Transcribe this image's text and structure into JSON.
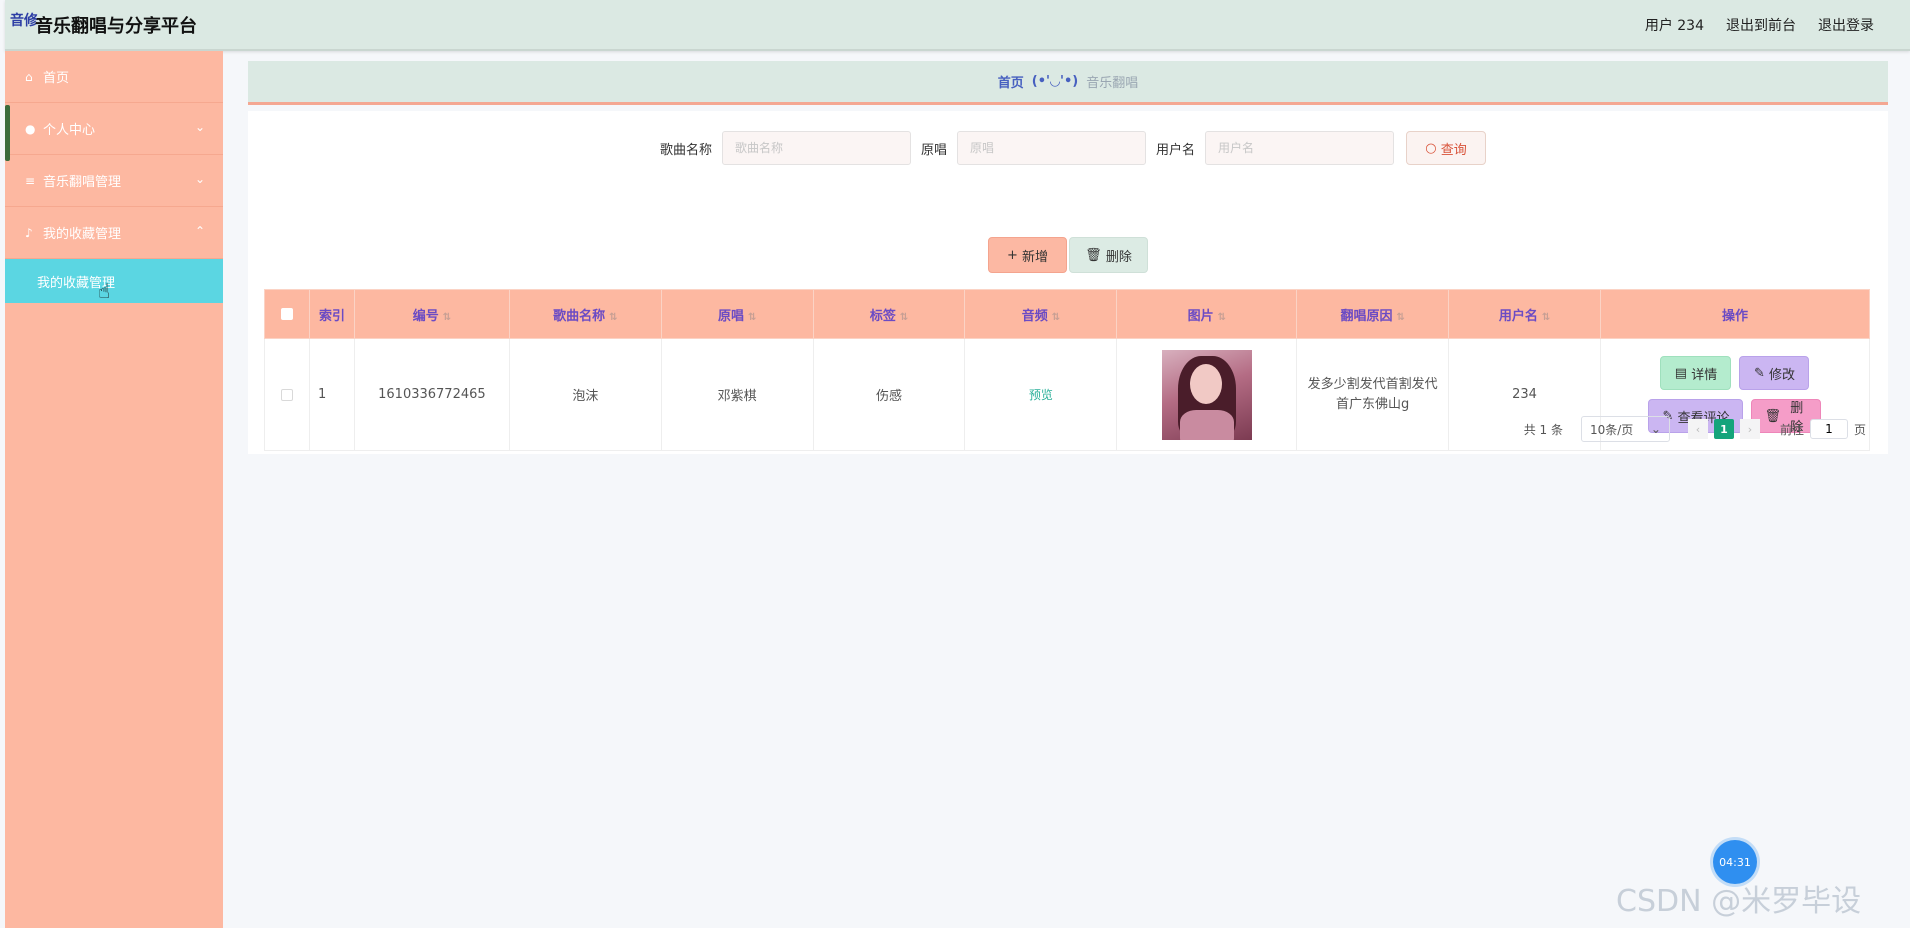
{
  "app": {
    "logo_badge": "音修",
    "title": "音乐翻唱与分享平台",
    "user_label": "用户 234",
    "to_front": "退出到前台",
    "logout": "退出登录"
  },
  "sidebar": {
    "items": [
      {
        "label": "首页",
        "icon": "home-icon"
      },
      {
        "label": "个人中心",
        "icon": "user-icon",
        "chevron": "⌄"
      },
      {
        "label": "音乐翻唱管理",
        "icon": "list-icon",
        "chevron": "⌄"
      },
      {
        "label": "我的收藏管理",
        "icon": "mic-icon",
        "chevron": "⌃"
      }
    ],
    "sub_item": "我的收藏管理"
  },
  "breadcrumb": {
    "home": "首页",
    "face": "(•'◡'•)",
    "current": "音乐翻唱"
  },
  "search": {
    "song_label": "歌曲名称",
    "song_placeholder": "歌曲名称",
    "original_label": "原唱",
    "original_placeholder": "原唱",
    "user_label": "用户名",
    "user_placeholder": "用户名",
    "query_btn": "查询"
  },
  "actions": {
    "add": "新增",
    "delete": "删除"
  },
  "table": {
    "headers": {
      "index": "索引",
      "id": "编号",
      "song": "歌曲名称",
      "original": "原唱",
      "tag": "标签",
      "audio": "音频",
      "image": "图片",
      "reason": "翻唱原因",
      "username": "用户名",
      "ops": "操作"
    },
    "rows": [
      {
        "index": "1",
        "id": "1610336772465",
        "song": "泡沫",
        "original": "邓紫棋",
        "tag": "伤感",
        "audio": "预览",
        "reason": "发多少割发代首割发代首广东佛山g",
        "username": "234",
        "ops": {
          "detail": "详情",
          "edit": "修改",
          "comment": "查看评论",
          "delete": "删除"
        }
      }
    ]
  },
  "pagination": {
    "total": "共 1 条",
    "page_size": "10条/页",
    "current": "1",
    "goto_label": "前往",
    "goto_value": "1",
    "page_suffix": "页"
  },
  "overlay": {
    "timer": "04:31",
    "watermark": "CSDN @米罗毕设"
  },
  "colors": {
    "sidebar": "#fdb8a1",
    "active_sub": "#5bd6e2",
    "header": "#dbe9e3",
    "accent_purple": "#6b4bc4",
    "pager_active": "#15a47b"
  }
}
